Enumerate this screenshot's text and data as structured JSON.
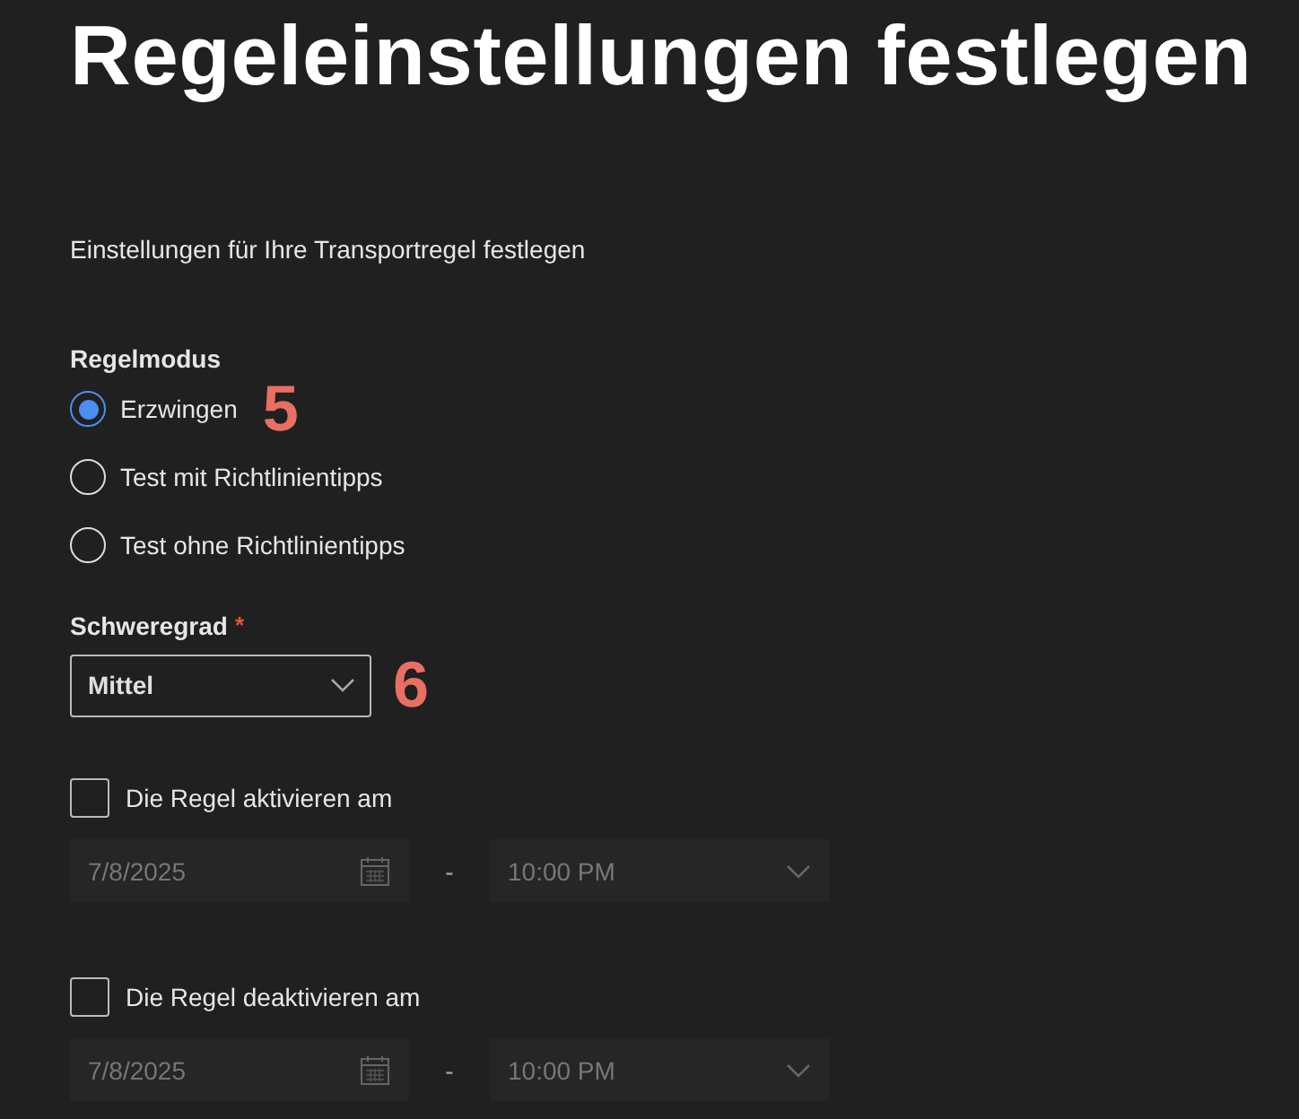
{
  "title": "Regeleinstellungen festlegen",
  "subtitle": "Einstellungen für Ihre Transportregel festlegen",
  "rule_mode": {
    "label": "Regelmodus",
    "callout": "5",
    "options": [
      {
        "label": "Erzwingen",
        "selected": true
      },
      {
        "label": "Test mit Richtlinientipps",
        "selected": false
      },
      {
        "label": "Test ohne Richtlinientipps",
        "selected": false
      }
    ]
  },
  "severity": {
    "label": "Schweregrad",
    "required_mark": "*",
    "value": "Mittel",
    "callout": "6"
  },
  "schedules": [
    {
      "label": "Die Regel aktivieren am",
      "checked": false,
      "date": "7/8/2025",
      "separator": "-",
      "time": "10:00 PM"
    },
    {
      "label": "Die Regel deaktivieren am",
      "checked": false,
      "date": "7/8/2025",
      "separator": "-",
      "time": "10:00 PM"
    }
  ]
}
